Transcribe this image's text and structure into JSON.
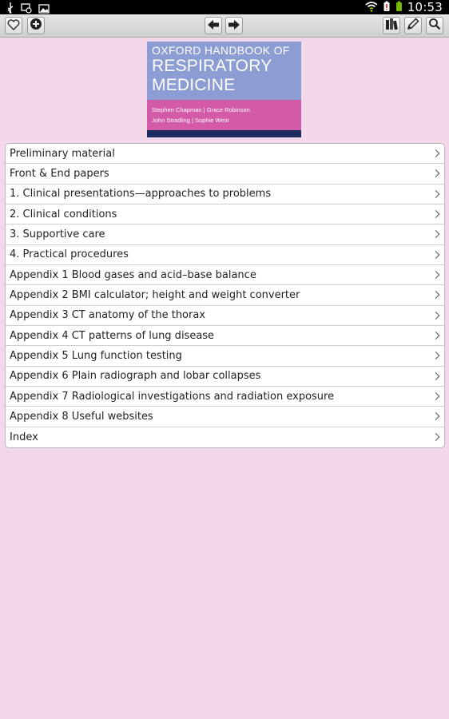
{
  "status_bar": {
    "time": "10:53",
    "left_icons": [
      "usb-icon",
      "screen-cast-icon",
      "image-icon"
    ],
    "right_icons": [
      "wifi-icon",
      "battery-alert-icon",
      "battery-icon"
    ]
  },
  "toolbar": {
    "buttons": [
      "favorite-button",
      "add-button",
      "back-button",
      "forward-button",
      "library-button",
      "edit-button",
      "search-button"
    ]
  },
  "book": {
    "title_line1": "OXFORD HANDBOOK OF",
    "title_line2": "RESPIRATORY",
    "title_line3": "MEDICINE",
    "authors_line1": "Stephen Chapman | Grace Robinson",
    "authors_line2": "John Stradling | Sophie West"
  },
  "toc": {
    "items": [
      {
        "label": "Preliminary material"
      },
      {
        "label": "Front & End papers"
      },
      {
        "label": "1. Clinical presentations—approaches to problems"
      },
      {
        "label": "2. Clinical conditions"
      },
      {
        "label": "3. Supportive care"
      },
      {
        "label": "4. Practical procedures"
      },
      {
        "label": "Appendix 1 Blood gases and acid–base balance"
      },
      {
        "label": "Appendix 2 BMI calculator; height and weight converter"
      },
      {
        "label": "Appendix 3 CT anatomy of the thorax"
      },
      {
        "label": "Appendix 4 CT patterns of lung disease"
      },
      {
        "label": "Appendix 5 Lung function testing"
      },
      {
        "label": "Appendix 6 Plain radiograph and lobar collapses"
      },
      {
        "label": "Appendix 7 Radiological investigations and radiation exposure"
      },
      {
        "label": "Appendix 8 Useful websites"
      },
      {
        "label": "Index"
      }
    ]
  },
  "colors": {
    "background": "#f2d8ea",
    "cover_blue": "#8b9dd2",
    "cover_pink": "#d25aa6",
    "cover_navy": "#1c2b60"
  }
}
